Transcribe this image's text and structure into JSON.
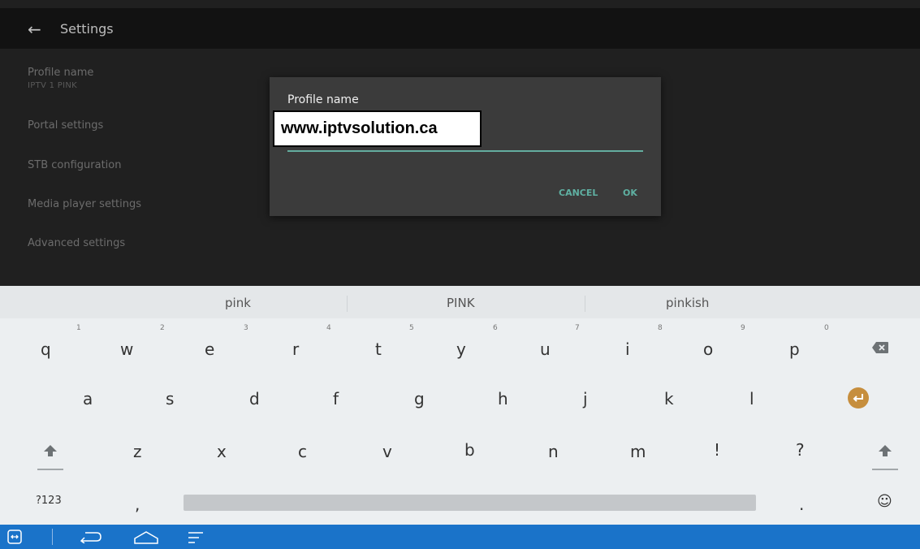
{
  "appbar": {
    "back_icon": "←",
    "title": "Settings"
  },
  "settings": {
    "profile_name": {
      "label": "Profile name",
      "value": "IPTV 1 PINK"
    },
    "portal": "Portal settings",
    "stb": "STB configuration",
    "media": "Media player settings",
    "advanced": "Advanced settings"
  },
  "dialog": {
    "title": "Profile name",
    "cancel": "CANCEL",
    "ok": "OK"
  },
  "overlay_text": "www.iptvsolution.ca",
  "keyboard": {
    "suggestions": [
      "pink",
      "PINK",
      "pinkish"
    ],
    "row1": [
      "q",
      "w",
      "e",
      "r",
      "t",
      "y",
      "u",
      "i",
      "o",
      "p"
    ],
    "row1_hints": [
      "1",
      "2",
      "3",
      "4",
      "5",
      "6",
      "7",
      "8",
      "9",
      "0"
    ],
    "row2": [
      "a",
      "s",
      "d",
      "f",
      "g",
      "h",
      "j",
      "k",
      "l"
    ],
    "row3": [
      "z",
      "x",
      "c",
      "v",
      "b",
      "n",
      "m",
      "!",
      "?"
    ],
    "row4": {
      "symbols": "?123",
      "comma": ",",
      "period": ".",
      "emoji": "☺"
    }
  },
  "accent_color": "#1a73c9",
  "enter_color": "#c68e3d"
}
